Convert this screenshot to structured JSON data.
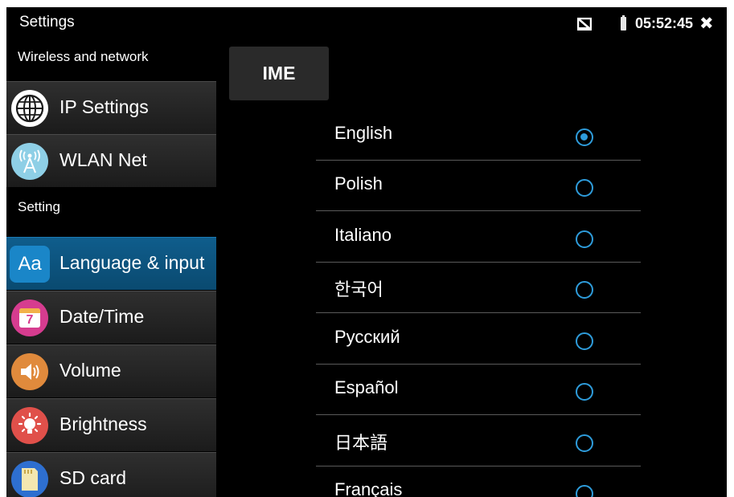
{
  "status_bar": {
    "title": "Settings",
    "time": "05:52:45",
    "close_symbol": "✖",
    "icons": [
      "no-sim-icon",
      "battery-icon",
      "close-icon"
    ]
  },
  "sidebar": {
    "sections": [
      {
        "header": "Wireless and network",
        "items": [
          {
            "label": "IP Settings",
            "icon": "globe-icon"
          },
          {
            "label": "WLAN Net",
            "icon": "antenna-icon"
          }
        ]
      },
      {
        "header": "Setting",
        "items": [
          {
            "label": "Language & input",
            "icon": "language-icon",
            "icon_text": "Aa",
            "active": true
          },
          {
            "label": "Date/Time",
            "icon": "calendar-icon",
            "icon_text": "7"
          },
          {
            "label": "Volume",
            "icon": "speaker-icon"
          },
          {
            "label": "Brightness",
            "icon": "brightness-icon"
          },
          {
            "label": "SD card",
            "icon": "sd-card-icon"
          }
        ]
      }
    ]
  },
  "main": {
    "title": "IME",
    "languages": [
      {
        "label": "English",
        "selected": true
      },
      {
        "label": "Polish",
        "selected": false
      },
      {
        "label": "Italiano",
        "selected": false
      },
      {
        "label": "한국어",
        "selected": false
      },
      {
        "label": "Русский",
        "selected": false
      },
      {
        "label": "Español",
        "selected": false
      },
      {
        "label": "日本語",
        "selected": false
      },
      {
        "label": "Français",
        "selected": false
      }
    ]
  },
  "colors": {
    "background": "#000000",
    "active_item": "#0f5d8c",
    "radio": "#2e9cdb",
    "calendar_icon": "#d63c8f",
    "volume_icon": "#e08a3c",
    "brightness_icon": "#e0504a",
    "sd_icon": "#2e6fd0"
  }
}
